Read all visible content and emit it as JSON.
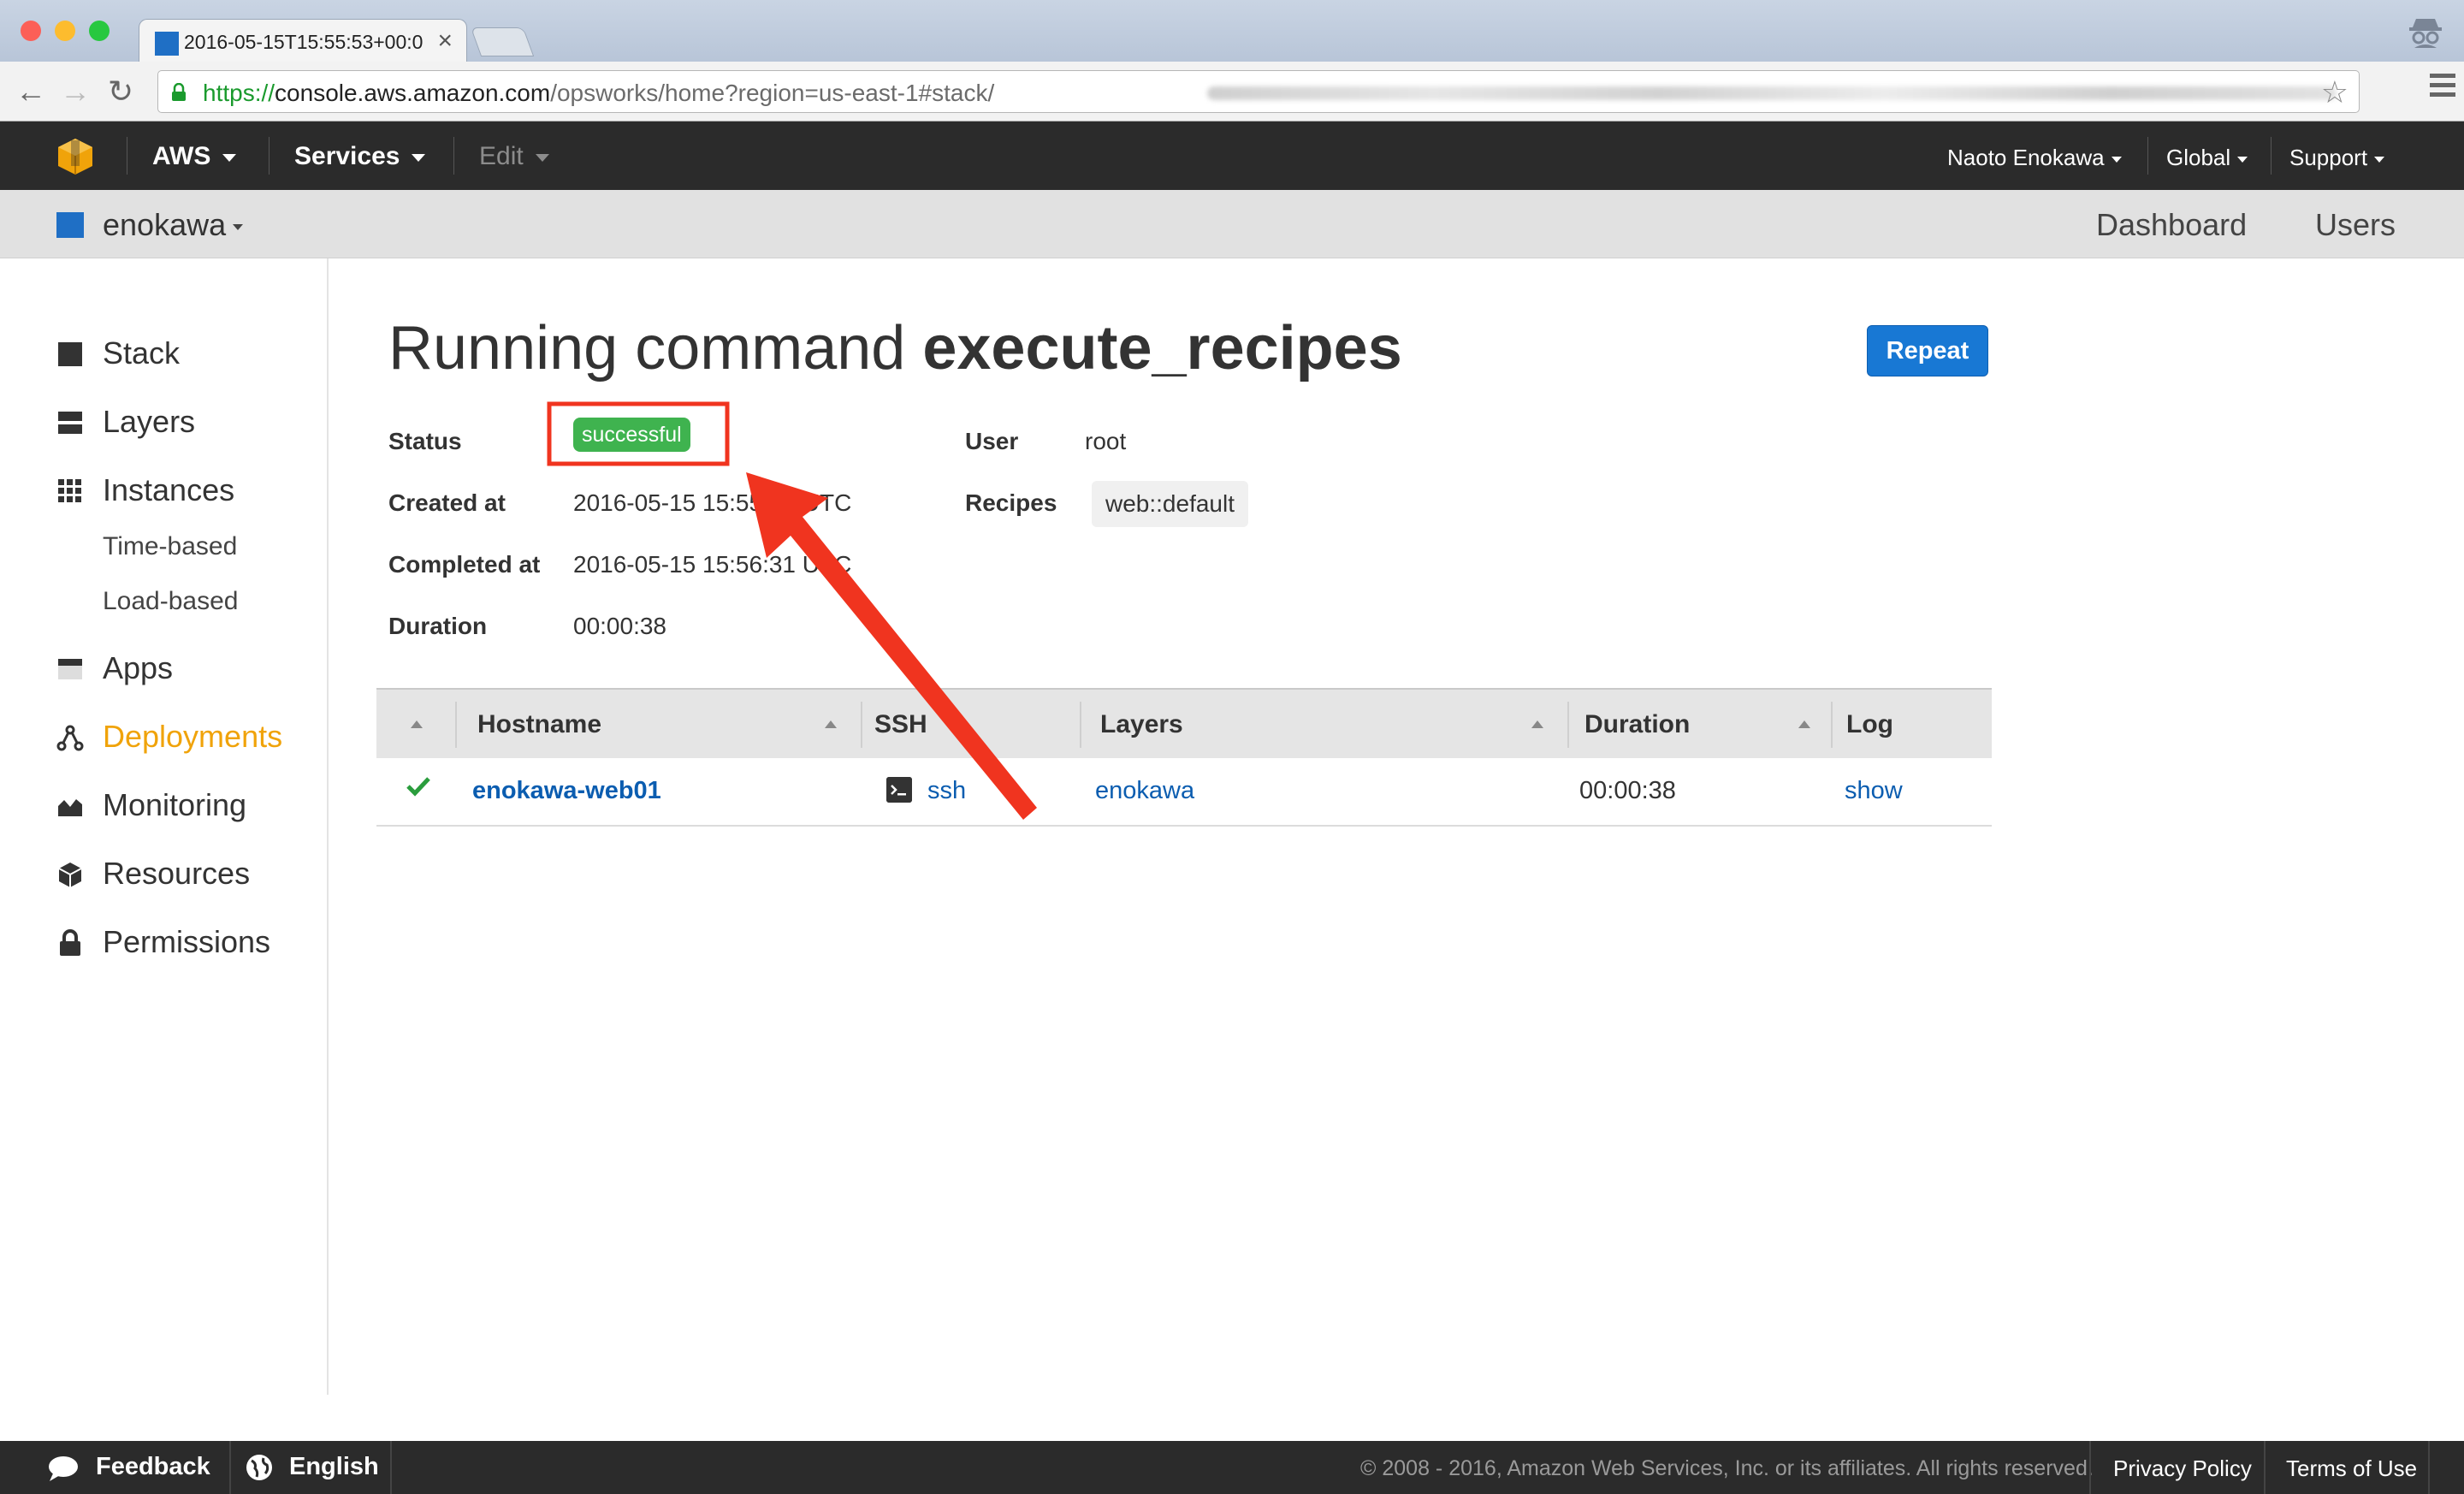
{
  "browser": {
    "tab_title": "2016-05-15T15:55:53+00:0",
    "url_protocol": "https://",
    "url_host": "console.aws.amazon.com",
    "url_path": "/opsworks/home?region=us-east-1#stack/"
  },
  "aws_nav": {
    "aws_label": "AWS",
    "services_label": "Services",
    "edit_label": "Edit",
    "user_label": "Naoto Enokawa",
    "region_label": "Global",
    "support_label": "Support"
  },
  "stack_bar": {
    "stack_name": "enokawa",
    "dashboard_link": "Dashboard",
    "users_link": "Users",
    "accent_color": "#1f6fc5"
  },
  "sidebar": {
    "items": [
      {
        "label": "Stack",
        "icon": "stack-icon"
      },
      {
        "label": "Layers",
        "icon": "layers-icon"
      },
      {
        "label": "Instances",
        "icon": "instances-icon"
      },
      {
        "label": "Apps",
        "icon": "apps-icon"
      },
      {
        "label": "Deployments",
        "icon": "deployments-icon",
        "active": true
      },
      {
        "label": "Monitoring",
        "icon": "monitoring-icon"
      },
      {
        "label": "Resources",
        "icon": "resources-icon"
      },
      {
        "label": "Permissions",
        "icon": "lock-icon"
      }
    ],
    "instances_sub": [
      "Time-based",
      "Load-based"
    ],
    "active_color": "#f0a30a"
  },
  "page": {
    "title_prefix": "Running command ",
    "title_command": "execute_recipes",
    "repeat_button": "Repeat"
  },
  "details": {
    "status_label": "Status",
    "status_value": "successful",
    "created_label": "Created at",
    "created_value": "2016-05-15 15:55:53 UTC",
    "completed_label": "Completed at",
    "completed_value": "2016-05-15 15:56:31 UTC",
    "duration_label": "Duration",
    "duration_value": "00:00:38",
    "user_label": "User",
    "user_value": "root",
    "recipes_label": "Recipes",
    "recipes_value": "web::default",
    "success_color": "#3fb34f"
  },
  "table": {
    "columns": [
      "Hostname",
      "SSH",
      "Layers",
      "Duration",
      "Log"
    ],
    "rows": [
      {
        "hostname": "enokawa-web01",
        "ssh": "ssh",
        "layer": "enokawa",
        "duration": "00:00:38",
        "log": "show",
        "status_icon": "check-icon"
      }
    ]
  },
  "footer": {
    "feedback": "Feedback",
    "language": "English",
    "copyright": "© 2008 - 2016, Amazon Web Services, Inc. or its affiliates. All rights reserved.",
    "privacy": "Privacy Policy",
    "terms": "Terms of Use"
  }
}
